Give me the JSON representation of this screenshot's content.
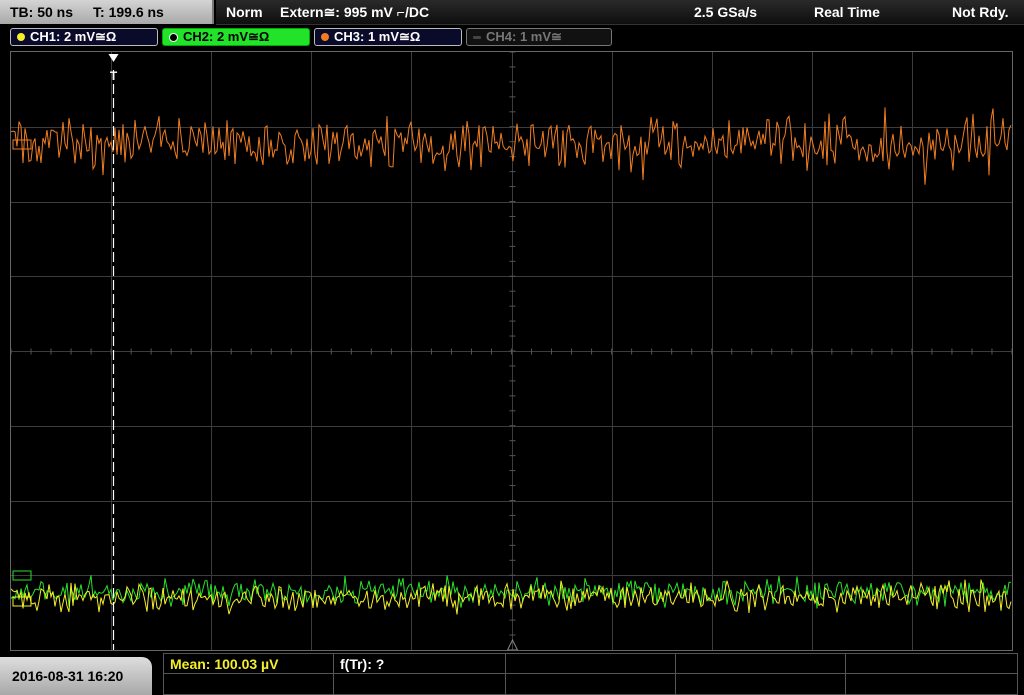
{
  "status": {
    "timebase": "TB: 50 ns",
    "trigger_time": "T: 199.6 ns",
    "mode": "Norm",
    "trigger_source": "Extern≅: 995 mV ⌐/DC",
    "sample_rate": "2.5 GSa/s",
    "acq_mode": "Real Time",
    "state": "Not Rdy."
  },
  "channels": [
    {
      "label": "CH1: 2 mV≅Ω",
      "color": "#f5ef2a",
      "active": false
    },
    {
      "label": "CH2: 2 mV≅Ω",
      "color": "#28e02a",
      "active": true
    },
    {
      "label": "CH3: 1 mV≅Ω",
      "color": "#f07d22",
      "active": false
    },
    {
      "label": "CH4: 1 mV≅",
      "color": "#777777",
      "active": false
    }
  ],
  "trigger_marker": "T",
  "footer": {
    "datetime": "2016-08-31 16:20",
    "mean": "Mean: 100.03 µV",
    "ftr": "f(Tr): ?"
  },
  "colors": {
    "ch1": "#f5ef2a",
    "ch2": "#28e02a",
    "ch3": "#f07d22",
    "grid": "#3c3c3c"
  }
}
